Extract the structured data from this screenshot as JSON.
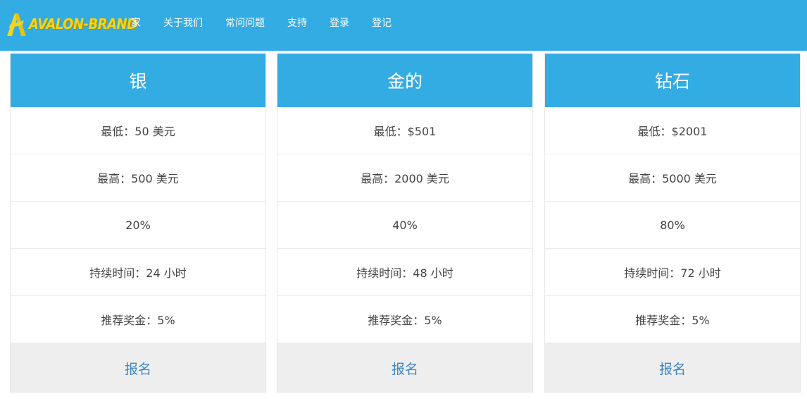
{
  "brand": {
    "name": "AVALON-BRAND",
    "accent_color": "#33ace4",
    "logo_color": "#f4d51b"
  },
  "nav": {
    "links": [
      {
        "label": "家"
      },
      {
        "label": "关于我们"
      },
      {
        "label": "常问问题"
      },
      {
        "label": "支持"
      },
      {
        "label": "登录"
      },
      {
        "label": "登记"
      }
    ]
  },
  "plans": [
    {
      "name": "银",
      "rows": [
        "最低：50 美元",
        "最高：500 美元",
        "20%",
        "持续时间：24 小时",
        "推荐奖金：5%"
      ],
      "cta": "报名"
    },
    {
      "name": "金的",
      "rows": [
        "最低：$501",
        "最高：2000 美元",
        "40%",
        "持续时间：48 小时",
        "推荐奖金：5%"
      ],
      "cta": "报名"
    },
    {
      "name": "钻石",
      "rows": [
        "最低：$2001",
        "最高：5000 美元",
        "80%",
        "持续时间：72 小时",
        "推荐奖金：5%"
      ],
      "cta": "报名"
    }
  ]
}
